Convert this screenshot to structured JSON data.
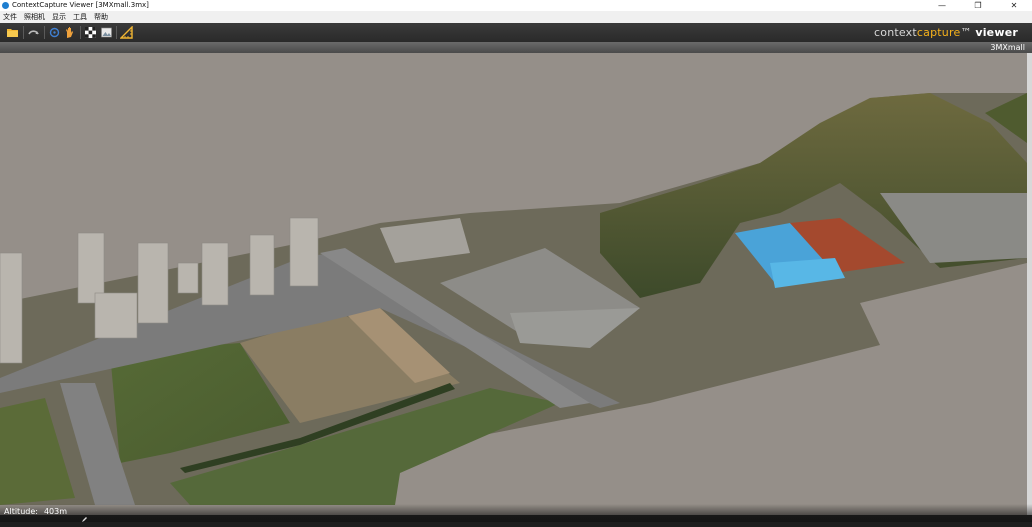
{
  "window": {
    "title": "ContextCapture Viewer [3MXmall.3mx]",
    "controls": [
      "—",
      "❐",
      "✕"
    ]
  },
  "menu": [
    {
      "label": "文件"
    },
    {
      "label": "照相机"
    },
    {
      "label": "显示"
    },
    {
      "label": "工具"
    },
    {
      "label": "帮助"
    }
  ],
  "toolbar": {
    "icons": [
      "open-folder-icon",
      "orbit-icon",
      "pan-icon",
      "hand-icon",
      "checker-icon",
      "photo-icon",
      "measure-icon"
    ]
  },
  "brand": {
    "prefix": "context",
    "highlight": "capture",
    "tm": "™",
    "suffix": "viewer"
  },
  "model_label": "3MXmall",
  "status": {
    "altitude_label": "Altitude:",
    "altitude_value": "403m"
  },
  "colors": {
    "sky": "#958f89",
    "accent": "#f6b21b",
    "toolbar": "#2e2e2e"
  }
}
